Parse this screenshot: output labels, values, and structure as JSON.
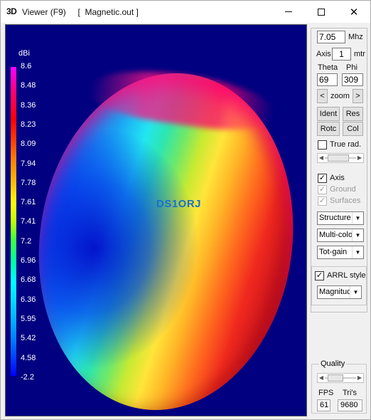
{
  "window": {
    "icon": "3D",
    "title": "Viewer (F9)     [  Magnetic.out ]",
    "minimize_icon": "minimize-icon",
    "maximize_icon": "maximize-icon",
    "close_icon": "close-icon"
  },
  "scale": {
    "unit": "dBi",
    "labels": [
      "8.6",
      "8.48",
      "8.36",
      "8.23",
      "8.09",
      "7.94",
      "7.78",
      "7.61",
      "7.41",
      "7.2",
      "6.96",
      "6.68",
      "6.36",
      "5.95",
      "5.42",
      "4.58",
      "-2.2"
    ],
    "colors": [
      "#ff00ff",
      "#ff0000",
      "#ffff00",
      "#00ffff",
      "#0000ff"
    ]
  },
  "viewport": {
    "background_color": "#000080",
    "callsign": "DS1ORJ"
  },
  "controls": {
    "frequency": "7.05",
    "frequency_unit": "Mhz",
    "axis_label": "Axis",
    "axis_value": "1",
    "axis_unit": "mtr",
    "theta_label": "Theta",
    "phi_label": "Phi",
    "theta_value": "69",
    "phi_value": "309",
    "zoom_label": "zoom",
    "zoom_left": "<",
    "zoom_right": ">",
    "ident_label": "Ident",
    "res_label": "Res",
    "rotc_label": "Rotc",
    "col_label": "Col",
    "true_rad_label": "True rad.",
    "true_rad_checked": false,
    "axis_check_label": "Axis",
    "axis_checked": true,
    "ground_label": "Ground",
    "ground_checked": true,
    "surfaces_label": "Surfaces",
    "surfaces_checked": true,
    "structure_select": "Structure",
    "color_select": "Multi-colo",
    "gain_select": "Tot-gain",
    "arrl_label": "ARRL style",
    "arrl_checked": true,
    "magnitude_select": "Magnitud",
    "quality_label": "Quality",
    "fps_label": "FPS",
    "tris_label": "Tri's",
    "fps_value": "61",
    "tris_value": "9680"
  }
}
